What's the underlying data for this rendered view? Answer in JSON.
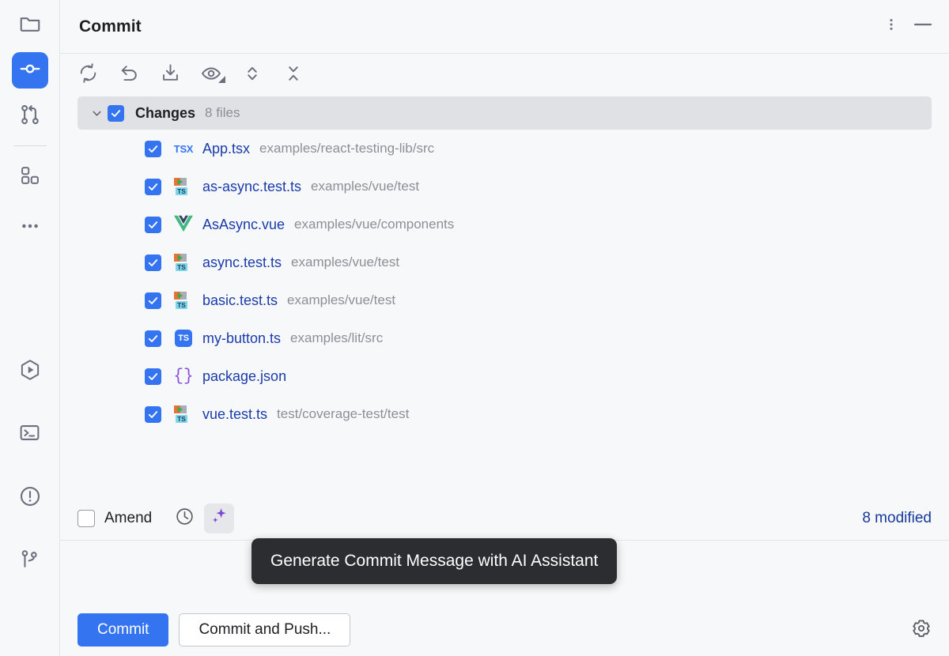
{
  "window": {
    "title": "Commit"
  },
  "header": {
    "title": "Commit",
    "more_options_icon": "vertical-dots-icon",
    "minimize_icon": "minimize-icon"
  },
  "rail": {
    "items": [
      {
        "name": "project-files",
        "icon": "folder-icon",
        "active": false
      },
      {
        "name": "commit",
        "icon": "commit-node-icon",
        "active": true
      },
      {
        "name": "pull-requests",
        "icon": "pull-request-icon",
        "active": false
      },
      {
        "name": "plugins",
        "icon": "grid-squares-icon",
        "active": false
      },
      {
        "name": "more-tool-windows",
        "icon": "horizontal-dots-icon",
        "active": false
      },
      {
        "name": "run",
        "icon": "run-hexagon-play-icon",
        "active": false
      },
      {
        "name": "terminal",
        "icon": "terminal-icon",
        "active": false
      },
      {
        "name": "problems",
        "icon": "exclamation-circle-icon",
        "active": false
      },
      {
        "name": "version-control-branch",
        "icon": "git-branch-icon",
        "active": false
      }
    ]
  },
  "toolbar": {
    "buttons": [
      {
        "name": "refresh-changes",
        "icon": "refresh-icon"
      },
      {
        "name": "rollback-changes",
        "icon": "undo-arrow-icon"
      },
      {
        "name": "update-project",
        "icon": "download-tray-icon"
      },
      {
        "name": "show-diff-preview",
        "icon": "eye-icon",
        "has_dropdown": true
      },
      {
        "name": "expand-all",
        "icon": "expand-chevrons-icon"
      },
      {
        "name": "collapse-all",
        "icon": "collapse-chevrons-icon"
      }
    ]
  },
  "changes_node": {
    "label": "Changes",
    "count_label": "8 files",
    "checked": true,
    "expanded": true
  },
  "files": [
    {
      "name": "App.tsx",
      "path": "examples/react-testing-lib/src",
      "icon": "tsx-file-icon",
      "icon_kind": "tsx",
      "checked": true
    },
    {
      "name": "as-async.test.ts",
      "path": "examples/vue/test",
      "icon": "ts-test-file-icon",
      "icon_kind": "test-ts",
      "checked": true
    },
    {
      "name": "AsAsync.vue",
      "path": "examples/vue/components",
      "icon": "vue-file-icon",
      "icon_kind": "vue",
      "checked": true
    },
    {
      "name": "async.test.ts",
      "path": "examples/vue/test",
      "icon": "ts-test-file-icon",
      "icon_kind": "test-ts",
      "checked": true
    },
    {
      "name": "basic.test.ts",
      "path": "examples/vue/test",
      "icon": "ts-test-file-icon",
      "icon_kind": "test-ts",
      "checked": true
    },
    {
      "name": "my-button.ts",
      "path": "examples/lit/src",
      "icon": "ts-file-icon",
      "icon_kind": "ts",
      "checked": true
    },
    {
      "name": "package.json",
      "path": "",
      "icon": "json-file-icon",
      "icon_kind": "json",
      "checked": true
    },
    {
      "name": "vue.test.ts",
      "path": "test/coverage-test/test",
      "icon": "ts-test-file-icon",
      "icon_kind": "test-ts",
      "checked": true
    }
  ],
  "amend_bar": {
    "amend_label": "Amend",
    "amend_checked": false,
    "history_icon": "clock-history-icon",
    "ai_icon": "ai-sparkle-icon",
    "modified_label": "8 modified"
  },
  "tooltip": {
    "text": "Generate Commit Message with AI Assistant"
  },
  "commit_message": {
    "value": "",
    "placeholder": ""
  },
  "bottom_bar": {
    "commit_label": "Commit",
    "commit_and_push_label": "Commit and Push...",
    "settings_icon": "gear-icon"
  },
  "colors": {
    "accent_blue": "#3574F0",
    "link_blue": "#17399E",
    "file_name_blue": "#1A3BAC",
    "muted_gray": "#8C8F96",
    "panel_bg": "#F7F8FA",
    "selection_bg": "#DFE1E5",
    "tooltip_bg": "#2B2D30",
    "ai_purple": "#7A49D8",
    "vue_green": "#41B883",
    "vue_dark": "#35495E",
    "border": "#E3E5E8"
  }
}
